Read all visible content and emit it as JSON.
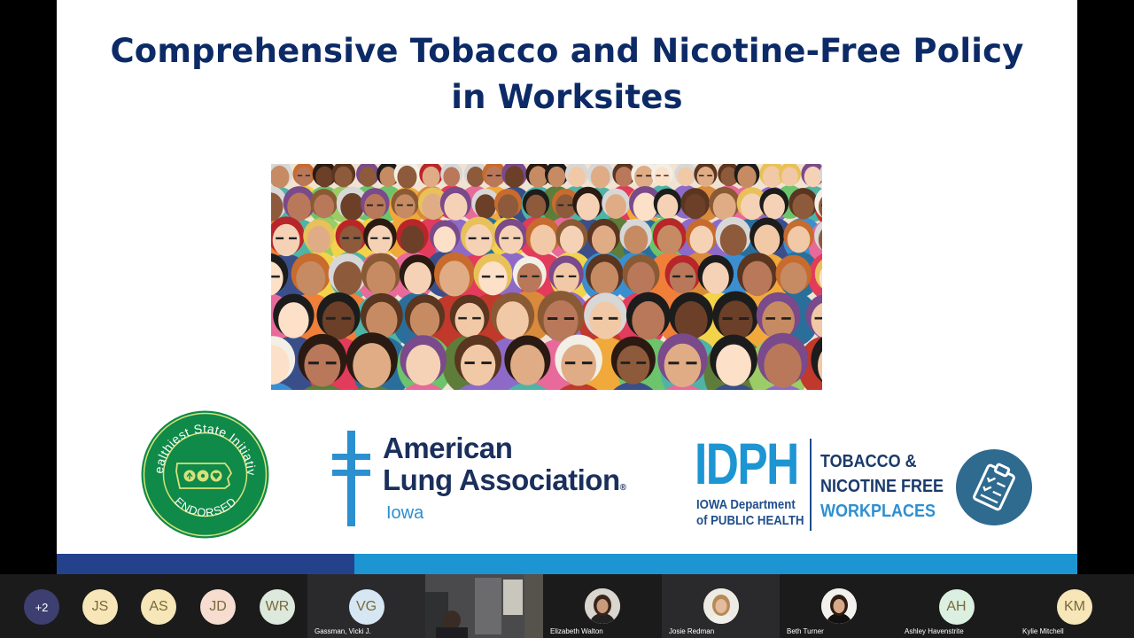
{
  "slide": {
    "title_line1": "Comprehensive Tobacco and Nicotine-Free Policy",
    "title_line2": "in Worksites"
  },
  "logos": {
    "seal": {
      "arc_top": "Healthiest State Initiative",
      "arc_bottom": "ENDORSED"
    },
    "ala": {
      "line1": "American",
      "line2": "Lung Association",
      "registered": "®",
      "region": "Iowa"
    },
    "idph": {
      "acronym": "IDPH",
      "sub_line1": "IOWA Department",
      "sub_line2": "of PUBLIC HEALTH",
      "program_line1": "TOBACCO &",
      "program_line2": "NICOTINE FREE",
      "program_line3": "WORKPLACES"
    }
  },
  "participants": [
    {
      "initials": "+2",
      "name": ""
    },
    {
      "initials": "JS",
      "name": ""
    },
    {
      "initials": "AS",
      "name": ""
    },
    {
      "initials": "JD",
      "name": ""
    },
    {
      "initials": "WR",
      "name": ""
    },
    {
      "initials": "VG",
      "name": "Gassman, Vicki J."
    },
    {
      "initials": "",
      "name": ""
    },
    {
      "initials": "",
      "name": "Elizabeth Walton"
    },
    {
      "initials": "",
      "name": "Josie Redman"
    },
    {
      "initials": "",
      "name": "Beth Turner"
    },
    {
      "initials": "AH",
      "name": "Ashley Havenstrite"
    },
    {
      "initials": "KM",
      "name": "Kylie Mitchell"
    }
  ],
  "colors": {
    "title": "#0c2a66",
    "ala_blue": "#1a2f5c",
    "idph_blue": "#1d95d3",
    "bar_dark": "#24418c",
    "bar_light": "#1d95d3",
    "seal_green": "#0f8a48",
    "avatar_more": "#3d3f70",
    "avatar_js": "#f6e6b8",
    "avatar_as": "#f6e6b8",
    "avatar_jd": "#f6ddd0",
    "avatar_wr": "#dde9dc",
    "avatar_vg": "#d6e7f3",
    "avatar_ah": "#dbf0e1",
    "avatar_km": "#f6e6b8"
  }
}
